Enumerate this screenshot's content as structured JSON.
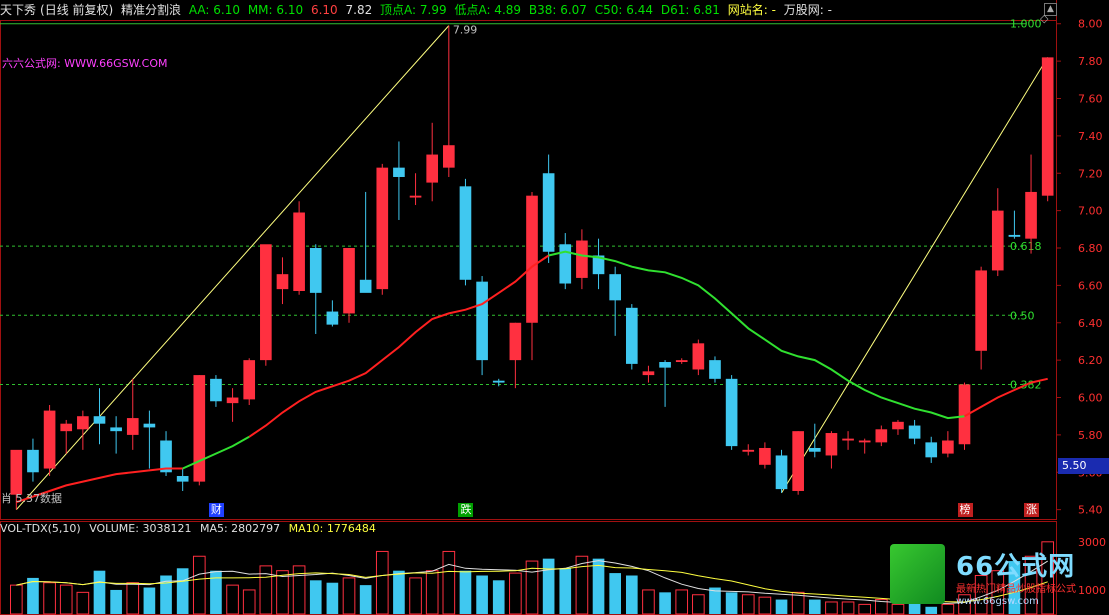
{
  "header": {
    "stock_title": "天下秀",
    "period": "(日线 前复权)",
    "indicator": "精准分割浪",
    "aa": "AA: 6.10",
    "mm": "MM: 6.10",
    "val_red": "6.10",
    "val_white": "7.82",
    "top_point": "顶点A: 7.99",
    "low_point": "低点A: 4.89",
    "b38": "B38: 6.07",
    "c50": "C50: 6.44",
    "d61": "D61: 6.81",
    "site_name": "网站名: -",
    "wangu": "万股网: -"
  },
  "site_label": "六六公式网: WWW.66GSW.COM",
  "last_price_label": "肖 5.37",
  "no_data_label": "数据",
  "peak_label": "7.99",
  "level_labels": {
    "top": "1.000",
    "fib618": "0.618",
    "fib50": "0.50",
    "fib382": "0.382"
  },
  "price_axis": [
    "8.00",
    "7.80",
    "7.60",
    "7.40",
    "7.20",
    "7.00",
    "6.80",
    "6.60",
    "6.40",
    "6.20",
    "6.00",
    "5.80",
    "5.60",
    "5.40"
  ],
  "current_price": "5.50",
  "events": [
    {
      "label": "财",
      "color": "#2040ff"
    },
    {
      "label": "跌",
      "color": "#00a000"
    },
    {
      "label": "榜",
      "color": "#c02020"
    },
    {
      "label": "涨",
      "color": "#c02020"
    }
  ],
  "volume_header": {
    "name": "VOL-TDX(5,10)",
    "volume": "VOLUME: 3038121",
    "ma5": "MA5: 2802797",
    "ma10": "MA10: 1776484"
  },
  "volume_axis": [
    "3000",
    "1000"
  ],
  "logo": {
    "title": "66公式网",
    "sub1": "最新热门精品炒股指标公式",
    "url": "www.66gsw.com"
  },
  "colors": {
    "up": "#ff3040",
    "down": "#40c8f0",
    "ma": "#ff2020",
    "ma_green": "#30e030",
    "fib_line": "#30c030"
  },
  "chart_data": {
    "type": "candlestick",
    "ylim": [
      5.35,
      8.02
    ],
    "candles": [
      {
        "o": 5.48,
        "h": 5.7,
        "l": 5.4,
        "c": 5.72
      },
      {
        "o": 5.72,
        "h": 5.78,
        "l": 5.55,
        "c": 5.6
      },
      {
        "o": 5.62,
        "h": 5.96,
        "l": 5.58,
        "c": 5.93
      },
      {
        "o": 5.82,
        "h": 5.88,
        "l": 5.7,
        "c": 5.86
      },
      {
        "o": 5.83,
        "h": 5.93,
        "l": 5.72,
        "c": 5.9
      },
      {
        "o": 5.9,
        "h": 6.05,
        "l": 5.75,
        "c": 5.86
      },
      {
        "o": 5.84,
        "h": 5.9,
        "l": 5.7,
        "c": 5.82
      },
      {
        "o": 5.8,
        "h": 6.1,
        "l": 5.72,
        "c": 5.89
      },
      {
        "o": 5.86,
        "h": 5.93,
        "l": 5.62,
        "c": 5.84
      },
      {
        "o": 5.77,
        "h": 5.82,
        "l": 5.58,
        "c": 5.6
      },
      {
        "o": 5.58,
        "h": 5.62,
        "l": 5.5,
        "c": 5.55
      },
      {
        "o": 5.55,
        "h": 6.12,
        "l": 5.53,
        "c": 6.12
      },
      {
        "o": 6.1,
        "h": 6.12,
        "l": 5.95,
        "c": 5.98
      },
      {
        "o": 5.97,
        "h": 6.05,
        "l": 5.87,
        "c": 6.0
      },
      {
        "o": 5.99,
        "h": 6.21,
        "l": 5.96,
        "c": 6.2
      },
      {
        "o": 6.2,
        "h": 6.8,
        "l": 6.17,
        "c": 6.82
      },
      {
        "o": 6.58,
        "h": 6.75,
        "l": 6.5,
        "c": 6.66
      },
      {
        "o": 6.57,
        "h": 7.05,
        "l": 6.55,
        "c": 6.99
      },
      {
        "o": 6.8,
        "h": 6.82,
        "l": 6.34,
        "c": 6.56
      },
      {
        "o": 6.46,
        "h": 6.52,
        "l": 6.38,
        "c": 6.39
      },
      {
        "o": 6.45,
        "h": 6.55,
        "l": 6.4,
        "c": 6.8
      },
      {
        "o": 6.63,
        "h": 7.1,
        "l": 6.58,
        "c": 6.56
      },
      {
        "o": 6.58,
        "h": 7.25,
        "l": 6.55,
        "c": 7.23
      },
      {
        "o": 7.23,
        "h": 7.37,
        "l": 6.95,
        "c": 7.18
      },
      {
        "o": 7.07,
        "h": 7.2,
        "l": 7.03,
        "c": 7.08
      },
      {
        "o": 7.15,
        "h": 7.47,
        "l": 7.05,
        "c": 7.3
      },
      {
        "o": 7.23,
        "h": 7.99,
        "l": 7.18,
        "c": 7.35
      },
      {
        "o": 7.13,
        "h": 7.17,
        "l": 6.6,
        "c": 6.63
      },
      {
        "o": 6.62,
        "h": 6.65,
        "l": 6.12,
        "c": 6.2
      },
      {
        "o": 6.09,
        "h": 6.1,
        "l": 6.06,
        "c": 6.08
      },
      {
        "o": 6.2,
        "h": 6.4,
        "l": 6.05,
        "c": 6.4
      },
      {
        "o": 6.4,
        "h": 7.1,
        "l": 6.2,
        "c": 7.08
      },
      {
        "o": 7.2,
        "h": 7.3,
        "l": 6.72,
        "c": 6.78
      },
      {
        "o": 6.82,
        "h": 6.88,
        "l": 6.58,
        "c": 6.61
      },
      {
        "o": 6.64,
        "h": 6.9,
        "l": 6.58,
        "c": 6.84
      },
      {
        "o": 6.76,
        "h": 6.85,
        "l": 6.58,
        "c": 6.66
      },
      {
        "o": 6.66,
        "h": 6.7,
        "l": 6.33,
        "c": 6.52
      },
      {
        "o": 6.48,
        "h": 6.5,
        "l": 6.15,
        "c": 6.18
      },
      {
        "o": 6.12,
        "h": 6.17,
        "l": 6.08,
        "c": 6.14
      },
      {
        "o": 6.19,
        "h": 6.2,
        "l": 5.95,
        "c": 6.16
      },
      {
        "o": 6.19,
        "h": 6.21,
        "l": 6.18,
        "c": 6.2
      },
      {
        "o": 6.15,
        "h": 6.31,
        "l": 6.12,
        "c": 6.29
      },
      {
        "o": 6.2,
        "h": 6.22,
        "l": 6.08,
        "c": 6.1
      },
      {
        "o": 6.1,
        "h": 6.12,
        "l": 5.72,
        "c": 5.74
      },
      {
        "o": 5.71,
        "h": 5.75,
        "l": 5.69,
        "c": 5.72
      },
      {
        "o": 5.64,
        "h": 5.76,
        "l": 5.62,
        "c": 5.73
      },
      {
        "o": 5.69,
        "h": 5.72,
        "l": 5.49,
        "c": 5.51
      },
      {
        "o": 5.5,
        "h": 5.82,
        "l": 5.48,
        "c": 5.82
      },
      {
        "o": 5.73,
        "h": 5.86,
        "l": 5.68,
        "c": 5.71
      },
      {
        "o": 5.69,
        "h": 5.82,
        "l": 5.62,
        "c": 5.81
      },
      {
        "o": 5.77,
        "h": 5.82,
        "l": 5.72,
        "c": 5.78
      },
      {
        "o": 5.76,
        "h": 5.78,
        "l": 5.7,
        "c": 5.77
      },
      {
        "o": 5.76,
        "h": 5.85,
        "l": 5.74,
        "c": 5.83
      },
      {
        "o": 5.83,
        "h": 5.88,
        "l": 5.8,
        "c": 5.87
      },
      {
        "o": 5.85,
        "h": 5.88,
        "l": 5.75,
        "c": 5.78
      },
      {
        "o": 5.76,
        "h": 5.79,
        "l": 5.65,
        "c": 5.68
      },
      {
        "o": 5.7,
        "h": 5.82,
        "l": 5.68,
        "c": 5.77
      },
      {
        "o": 5.75,
        "h": 6.08,
        "l": 5.72,
        "c": 6.07
      },
      {
        "o": 6.25,
        "h": 6.7,
        "l": 6.15,
        "c": 6.68
      },
      {
        "o": 6.68,
        "h": 7.12,
        "l": 6.65,
        "c": 7.0
      },
      {
        "o": 6.87,
        "h": 7.0,
        "l": 6.85,
        "c": 6.86
      },
      {
        "o": 6.85,
        "h": 7.3,
        "l": 6.77,
        "c": 7.1
      },
      {
        "o": 7.08,
        "h": 7.82,
        "l": 7.05,
        "c": 7.82
      }
    ],
    "ma_line": [
      5.44,
      5.47,
      5.5,
      5.53,
      5.55,
      5.57,
      5.59,
      5.6,
      5.61,
      5.62,
      5.62,
      5.66,
      5.7,
      5.74,
      5.79,
      5.85,
      5.92,
      5.98,
      6.03,
      6.06,
      6.09,
      6.13,
      6.2,
      6.27,
      6.35,
      6.42,
      6.45,
      6.47,
      6.5,
      6.56,
      6.62,
      6.7,
      6.76,
      6.78,
      6.76,
      6.75,
      6.73,
      6.7,
      6.68,
      6.67,
      6.64,
      6.6,
      6.53,
      6.45,
      6.37,
      6.31,
      6.25,
      6.22,
      6.2,
      6.15,
      6.09,
      6.04,
      6.0,
      5.97,
      5.94,
      5.92,
      5.89,
      5.9,
      5.95,
      6.0,
      6.04,
      6.08,
      6.1
    ],
    "fib_levels": [
      8.0,
      6.81,
      6.44,
      6.07
    ],
    "volume": [
      1200,
      1500,
      1300,
      1200,
      900,
      1800,
      1000,
      1300,
      1100,
      1600,
      1900,
      2400,
      1800,
      1200,
      1000,
      2000,
      1800,
      2000,
      1400,
      1300,
      1500,
      1200,
      2600,
      1800,
      1500,
      1800,
      2600,
      1800,
      1600,
      1400,
      1700,
      2200,
      2300,
      1900,
      2400,
      2300,
      1700,
      1600,
      1000,
      900,
      1000,
      800,
      1100,
      900,
      800,
      700,
      600,
      900,
      600,
      500,
      500,
      400,
      600,
      400,
      500,
      300,
      400,
      800,
      1600,
      1800,
      2200,
      2400,
      3000
    ],
    "volume_ylim": [
      0,
      3200
    ]
  }
}
